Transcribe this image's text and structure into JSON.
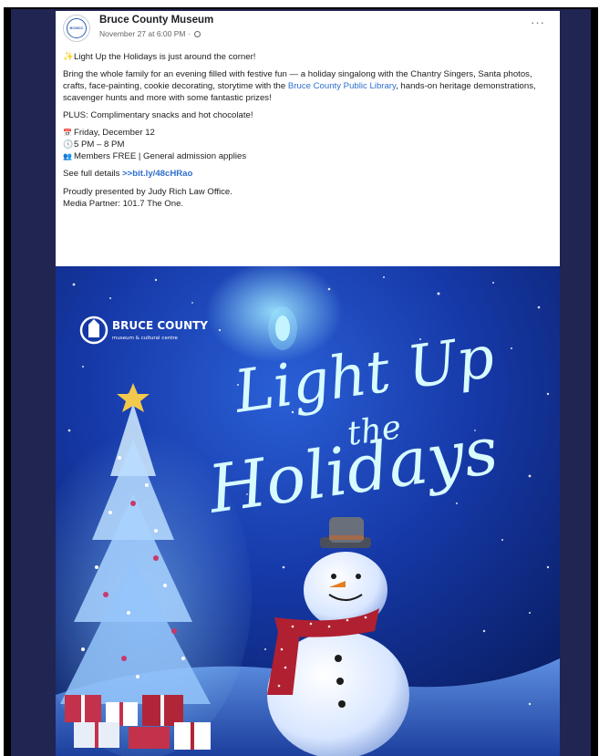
{
  "post": {
    "page_name": "Bruce County Museum",
    "timestamp": "November 27 at 6:00 PM ·",
    "avatar_text": "BCMCC",
    "more_label": "···",
    "headline": "Light Up the Holidays is just around the corner!",
    "description_part1": "Bring the whole family for an evening filled with festive fun — a holiday singalong with the Chantry Singers, Santa photos, crafts, face-painting, cookie decorating, storytime with the ",
    "library_link": "Bruce County Public Library",
    "description_part2": ", hands-on heritage demonstrations, scavenger hunts and more with some fantastic prizes!",
    "plus_line": "PLUS: Complimentary snacks and hot chocolate!",
    "date_line": "Friday, December 12",
    "time_line": "5 PM – 8 PM",
    "admission_line": "Members FREE | General admission applies",
    "details_prefix": "See full details ",
    "details_link": ">>bit.ly/48cHRao",
    "presented_line": "Proudly presented by Judy Rich Law Office.",
    "partner_line": "Media Partner: 101.7 The One."
  },
  "poster": {
    "logo_title": "BRUCE COUNTY",
    "logo_subtitle": "museum & cultural centre",
    "title_line1": "Light Up",
    "title_line2": "the",
    "title_line3": "Holidays"
  },
  "icons": {
    "headline": "sparkle-icon",
    "date": "calendar-icon",
    "time": "clock-icon",
    "admission": "people-icon",
    "privacy": "globe-icon"
  },
  "colors": {
    "link": "#2f6fcf",
    "background_navy": "#212552",
    "poster_sky": "#0d2a86",
    "title_glow": "#cbfaff"
  }
}
